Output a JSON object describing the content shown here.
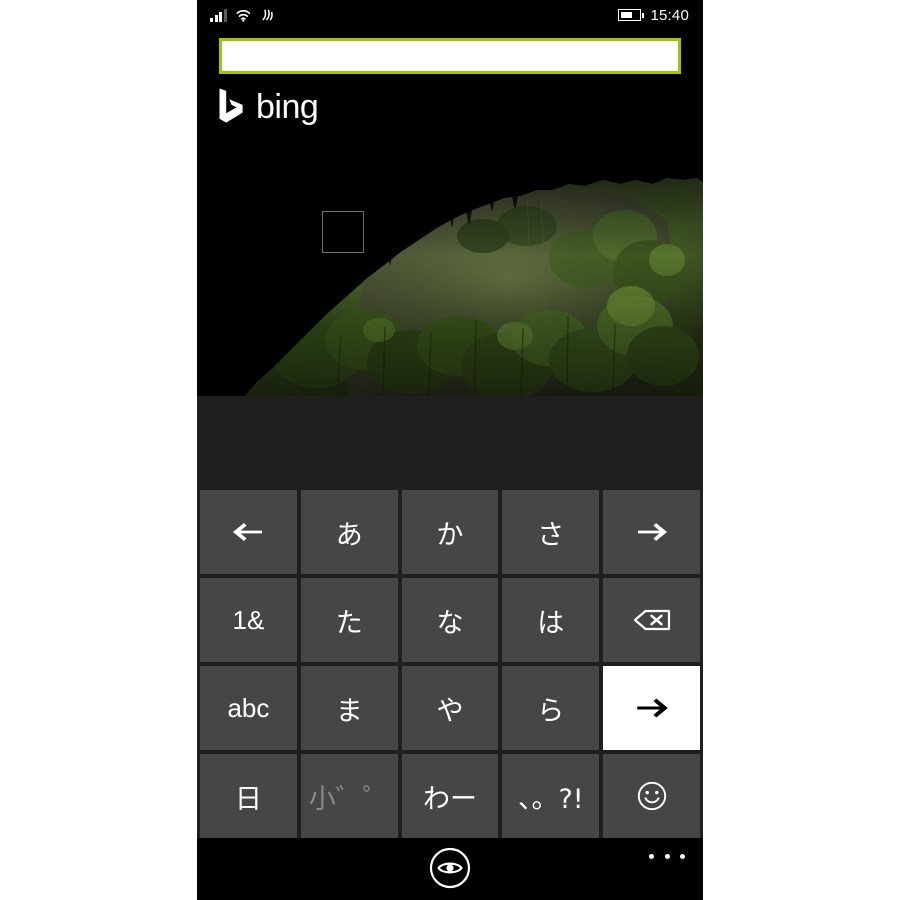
{
  "status_bar": {
    "signal_icon": "signal-bars-icon",
    "signal_bars_filled": 3,
    "signal_bars_total": 4,
    "wifi_icon": "wifi-icon",
    "data_icon": "data-transfer-icon",
    "battery_icon": "battery-icon",
    "battery_level_percent": 60,
    "time": "15:40"
  },
  "search": {
    "value": "",
    "placeholder": "",
    "accent_color": "#a4c400"
  },
  "branding": {
    "logo_icon": "bing-logo-icon",
    "wordmark": "bing"
  },
  "hero": {
    "name": "daily-wallpaper-image",
    "description": "Cave mouth opening onto a green forest",
    "hotspot_icon": "hotspot-square-icon"
  },
  "suggestions": {
    "items": []
  },
  "keyboard": {
    "layout": "japanese-kana-12key",
    "rows": [
      [
        {
          "name": "key-left-arrow",
          "label": "←",
          "icon": "arrow-left-icon",
          "style": "icon"
        },
        {
          "name": "key-a",
          "label": "あ",
          "style": "kana"
        },
        {
          "name": "key-ka",
          "label": "か",
          "style": "kana"
        },
        {
          "name": "key-sa",
          "label": "さ",
          "style": "kana"
        },
        {
          "name": "key-right-arrow",
          "label": "→",
          "icon": "arrow-right-icon",
          "style": "icon"
        }
      ],
      [
        {
          "name": "key-numbers-symbols",
          "label": "1&",
          "style": "latin"
        },
        {
          "name": "key-ta",
          "label": "た",
          "style": "kana"
        },
        {
          "name": "key-na",
          "label": "な",
          "style": "kana"
        },
        {
          "name": "key-ha",
          "label": "は",
          "style": "kana"
        },
        {
          "name": "key-backspace",
          "label": "⌫",
          "icon": "backspace-icon",
          "style": "icon"
        }
      ],
      [
        {
          "name": "key-abc",
          "label": "abc",
          "style": "latin"
        },
        {
          "name": "key-ma",
          "label": "ま",
          "style": "kana"
        },
        {
          "name": "key-ya",
          "label": "や",
          "style": "kana"
        },
        {
          "name": "key-ra",
          "label": "ら",
          "style": "kana"
        },
        {
          "name": "key-enter",
          "label": "→",
          "icon": "arrow-right-icon",
          "style": "accent"
        }
      ],
      [
        {
          "name": "key-japanese-mode",
          "label": "日",
          "style": "kana"
        },
        {
          "name": "key-small-dakuten",
          "label": "小゛゜",
          "style": "dim"
        },
        {
          "name": "key-wa",
          "label": "わー",
          "style": "kana"
        },
        {
          "name": "key-punctuation",
          "label": "、。?!",
          "style": "kana"
        },
        {
          "name": "key-emoji",
          "label": "☺",
          "icon": "smiley-icon",
          "style": "icon"
        }
      ]
    ]
  },
  "app_bar": {
    "vision_button_label": "",
    "vision_icon": "eye-in-circle-icon",
    "more_button_label": "",
    "more_icon": "ellipsis-icon"
  },
  "colors": {
    "screen_background": "#000000",
    "key_background": "#464646",
    "keyboard_background": "#1f1f1f",
    "accent": "#a4c400",
    "text": "#ffffff",
    "dim_text": "#8a8a8a"
  }
}
